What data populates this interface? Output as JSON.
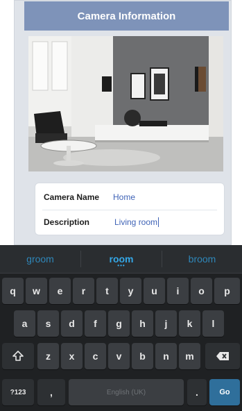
{
  "header": {
    "title": "Camera Information"
  },
  "form": {
    "name_label": "Camera Name",
    "name_value": "Home",
    "description_label": "Description",
    "description_value": "Living room"
  },
  "keyboard": {
    "suggestions": [
      "groom",
      "room",
      "broom"
    ],
    "row1": [
      "q",
      "w",
      "e",
      "r",
      "t",
      "y",
      "u",
      "i",
      "o",
      "p"
    ],
    "row2": [
      "a",
      "s",
      "d",
      "f",
      "g",
      "h",
      "j",
      "k",
      "l"
    ],
    "row3": [
      "z",
      "x",
      "c",
      "v",
      "b",
      "n",
      "m"
    ],
    "symbols_label": "?123",
    "comma_label": ",",
    "space_label": "English (UK)",
    "period_label": ".",
    "go_label": "Go",
    "shift_icon": "shift-icon",
    "backspace_icon": "backspace-icon"
  },
  "colors": {
    "header_bg": "#7e93b9",
    "accent": "#3f63b6",
    "suggestion": "#34a8e8",
    "go_key": "#2f6f9b"
  }
}
